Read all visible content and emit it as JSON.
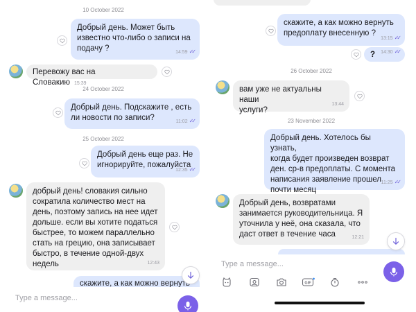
{
  "left": {
    "date_1": "10 October 2022",
    "msg_1": {
      "text": "Добрый день. Может быть\nизвестно что-либо о записи на\nподачу ?",
      "time": "14:59"
    },
    "msg_2": {
      "text": "Перевожу вас на Словакию",
      "time": "15:39"
    },
    "date_2": "24 October 2022",
    "msg_3": {
      "text": "Добрый день. Подскажите , есть\nли новости по записи?",
      "time": "11:02"
    },
    "date_3": "25 October 2022",
    "msg_4": {
      "text": "Добрый день еще раз. Не\nигнорируйте, пожалуйста",
      "time": "12:35"
    },
    "msg_5": {
      "text": "добрый день! словакия сильно\nсократила количество мест на\nдень, поэтому запись на нее идет\nдольше. если вы хотите податься\nбыстрее, то можем параллельно\nстать на грецию, она записывает\nбыстро, в течение одной-двух\nнедель",
      "time": "12:43"
    },
    "msg_6_partial": "скажите, а как можно вернуть",
    "input_placeholder": "Type a message..."
  },
  "right": {
    "msg_1": {
      "text": "скажите, а как можно вернуть\nпредоплату внесенную ?",
      "time": "13:15"
    },
    "msg_2": {
      "text": "?",
      "time": "14:30"
    },
    "date_1": "26 October 2022",
    "msg_3": {
      "text": "вам уже не актуальны наши\nуслуги?",
      "time": "13:44"
    },
    "date_2": "23 November 2022",
    "msg_4": {
      "text": "Добрый день. Хотелось бы узнать,\nкогда будет произведен возврат\nден. ср-в предоплаты. С момента\nнаписания заявление прошел\nпочти месяц",
      "time": "11:25"
    },
    "msg_5": {
      "text": "Добрый день, возвратами\nзанимается руководительница. Я\nуточнила у неё, она сказала, что\nдаст ответ в течение часа",
      "time": "12:21"
    },
    "input_placeholder": "Type a message..."
  },
  "colors": {
    "outgoing_bubble": "#dde7fd",
    "incoming_bubble": "#efefef",
    "accent": "#7b61e8",
    "read_ticks": "#6f62d9"
  },
  "icons": [
    "heart-icon",
    "chevron-down-icon",
    "microphone-icon",
    "sticker-icon",
    "gallery-icon",
    "camera-icon",
    "gif-icon",
    "timer-icon",
    "more-icon",
    "double-check-icon"
  ]
}
